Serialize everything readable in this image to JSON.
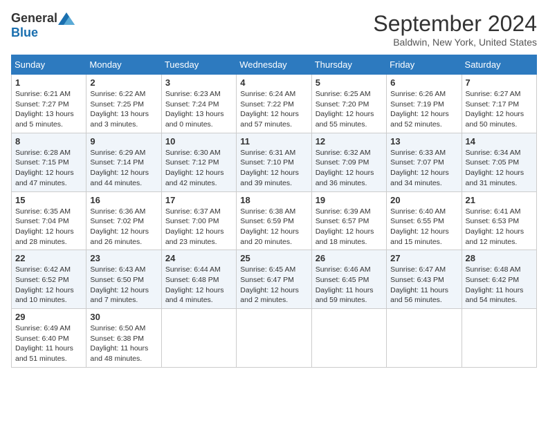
{
  "header": {
    "logo_general": "General",
    "logo_blue": "Blue",
    "month": "September 2024",
    "location": "Baldwin, New York, United States"
  },
  "days_of_week": [
    "Sunday",
    "Monday",
    "Tuesday",
    "Wednesday",
    "Thursday",
    "Friday",
    "Saturday"
  ],
  "weeks": [
    [
      {
        "day": 1,
        "sunrise": "6:21 AM",
        "sunset": "7:27 PM",
        "daylight": "13 hours and 5 minutes."
      },
      {
        "day": 2,
        "sunrise": "6:22 AM",
        "sunset": "7:25 PM",
        "daylight": "13 hours and 3 minutes."
      },
      {
        "day": 3,
        "sunrise": "6:23 AM",
        "sunset": "7:24 PM",
        "daylight": "13 hours and 0 minutes."
      },
      {
        "day": 4,
        "sunrise": "6:24 AM",
        "sunset": "7:22 PM",
        "daylight": "12 hours and 57 minutes."
      },
      {
        "day": 5,
        "sunrise": "6:25 AM",
        "sunset": "7:20 PM",
        "daylight": "12 hours and 55 minutes."
      },
      {
        "day": 6,
        "sunrise": "6:26 AM",
        "sunset": "7:19 PM",
        "daylight": "12 hours and 52 minutes."
      },
      {
        "day": 7,
        "sunrise": "6:27 AM",
        "sunset": "7:17 PM",
        "daylight": "12 hours and 50 minutes."
      }
    ],
    [
      {
        "day": 8,
        "sunrise": "6:28 AM",
        "sunset": "7:15 PM",
        "daylight": "12 hours and 47 minutes."
      },
      {
        "day": 9,
        "sunrise": "6:29 AM",
        "sunset": "7:14 PM",
        "daylight": "12 hours and 44 minutes."
      },
      {
        "day": 10,
        "sunrise": "6:30 AM",
        "sunset": "7:12 PM",
        "daylight": "12 hours and 42 minutes."
      },
      {
        "day": 11,
        "sunrise": "6:31 AM",
        "sunset": "7:10 PM",
        "daylight": "12 hours and 39 minutes."
      },
      {
        "day": 12,
        "sunrise": "6:32 AM",
        "sunset": "7:09 PM",
        "daylight": "12 hours and 36 minutes."
      },
      {
        "day": 13,
        "sunrise": "6:33 AM",
        "sunset": "7:07 PM",
        "daylight": "12 hours and 34 minutes."
      },
      {
        "day": 14,
        "sunrise": "6:34 AM",
        "sunset": "7:05 PM",
        "daylight": "12 hours and 31 minutes."
      }
    ],
    [
      {
        "day": 15,
        "sunrise": "6:35 AM",
        "sunset": "7:04 PM",
        "daylight": "12 hours and 28 minutes."
      },
      {
        "day": 16,
        "sunrise": "6:36 AM",
        "sunset": "7:02 PM",
        "daylight": "12 hours and 26 minutes."
      },
      {
        "day": 17,
        "sunrise": "6:37 AM",
        "sunset": "7:00 PM",
        "daylight": "12 hours and 23 minutes."
      },
      {
        "day": 18,
        "sunrise": "6:38 AM",
        "sunset": "6:59 PM",
        "daylight": "12 hours and 20 minutes."
      },
      {
        "day": 19,
        "sunrise": "6:39 AM",
        "sunset": "6:57 PM",
        "daylight": "12 hours and 18 minutes."
      },
      {
        "day": 20,
        "sunrise": "6:40 AM",
        "sunset": "6:55 PM",
        "daylight": "12 hours and 15 minutes."
      },
      {
        "day": 21,
        "sunrise": "6:41 AM",
        "sunset": "6:53 PM",
        "daylight": "12 hours and 12 minutes."
      }
    ],
    [
      {
        "day": 22,
        "sunrise": "6:42 AM",
        "sunset": "6:52 PM",
        "daylight": "12 hours and 10 minutes."
      },
      {
        "day": 23,
        "sunrise": "6:43 AM",
        "sunset": "6:50 PM",
        "daylight": "12 hours and 7 minutes."
      },
      {
        "day": 24,
        "sunrise": "6:44 AM",
        "sunset": "6:48 PM",
        "daylight": "12 hours and 4 minutes."
      },
      {
        "day": 25,
        "sunrise": "6:45 AM",
        "sunset": "6:47 PM",
        "daylight": "12 hours and 2 minutes."
      },
      {
        "day": 26,
        "sunrise": "6:46 AM",
        "sunset": "6:45 PM",
        "daylight": "11 hours and 59 minutes."
      },
      {
        "day": 27,
        "sunrise": "6:47 AM",
        "sunset": "6:43 PM",
        "daylight": "11 hours and 56 minutes."
      },
      {
        "day": 28,
        "sunrise": "6:48 AM",
        "sunset": "6:42 PM",
        "daylight": "11 hours and 54 minutes."
      }
    ],
    [
      {
        "day": 29,
        "sunrise": "6:49 AM",
        "sunset": "6:40 PM",
        "daylight": "11 hours and 51 minutes."
      },
      {
        "day": 30,
        "sunrise": "6:50 AM",
        "sunset": "6:38 PM",
        "daylight": "11 hours and 48 minutes."
      },
      null,
      null,
      null,
      null,
      null
    ]
  ]
}
